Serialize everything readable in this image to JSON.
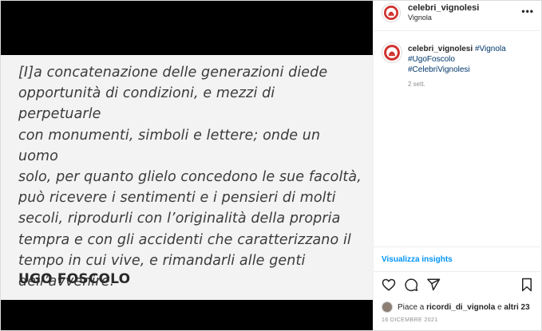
{
  "post": {
    "quote": "[I]a concatenazione delle generazioni diede\nopportunità di condizioni, e mezzi di perpetuarle\ncon monumenti, simboli e lettere; onde un uomo\nsolo, per quanto glielo concedono le sue facoltà,\npuò ricevere i sentimenti e i pensieri di molti\nsecoli, riprodurli con l’originalità della propria\ntempra e con gli accidenti che caratterizzano il\ntempo in cui vive, e rimandarli alle genti\ndell’avvenire.",
    "author": "UGO FOSCOLO"
  },
  "header": {
    "username": "celebri_vignolesi",
    "location": "Vignola",
    "avatar_icon": "celebri-vignolesi-logo-icon",
    "more_icon": "more-options-icon"
  },
  "caption": {
    "username": "celebri_vignolesi",
    "hashtags": [
      "#Vignola",
      "#UgoFoscolo",
      "#CelebriVignolesi"
    ],
    "time": "2 sett."
  },
  "insights": {
    "label": "Visualizza insights"
  },
  "actions": {
    "icons": [
      "heart-icon",
      "comment-icon",
      "share-icon",
      "bookmark-icon"
    ]
  },
  "likes": {
    "prefix": "Piace a",
    "user": "ricordi_di_vignola",
    "conj": "e",
    "others": "altri 23"
  },
  "date": "16 DICEMBRE 2021",
  "colors": {
    "accent_link": "#0095f6",
    "hashtag": "#00376b",
    "logo_red": "#d0312d",
    "media_bg": "#000000",
    "card_bg": "#f3f3f3"
  }
}
